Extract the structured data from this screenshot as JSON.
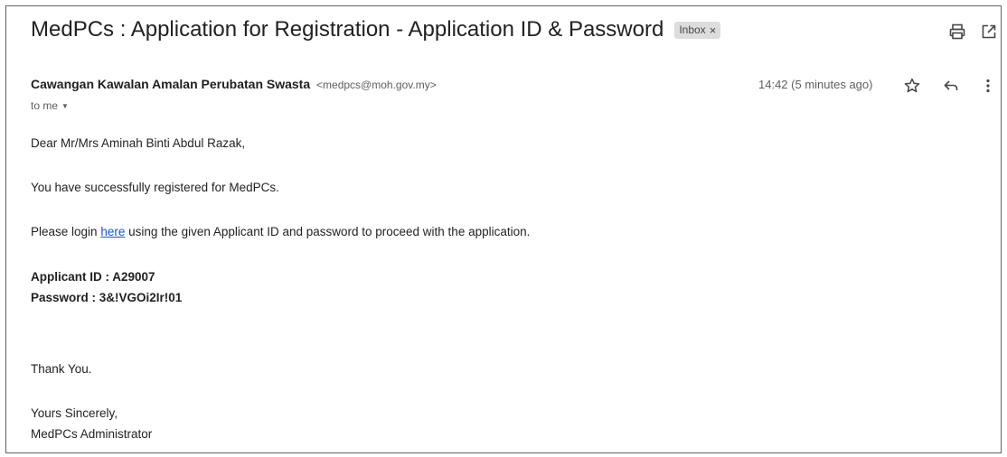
{
  "email": {
    "subject": "MedPCs : Application for Registration - Application ID & Password",
    "label_badge": "Inbox",
    "label_remove": "×",
    "sender_name": "Cawangan Kawalan Amalan Perubatan Swasta",
    "sender_email": "<medpcs@moh.gov.my>",
    "recipient": "to me",
    "timestamp": "14:42 (5 minutes ago)"
  },
  "body": {
    "greeting": "Dear Mr/Mrs Aminah Binti Abdul Razak,",
    "line1": "You have successfully registered for MedPCs.",
    "login_prefix": "Please login ",
    "login_link": "here",
    "login_suffix": " using the given Applicant ID and password to proceed with the application.",
    "applicant_id": "Applicant ID : A29007",
    "password": "Password : 3&!VGOi2Ir!01",
    "thanks": "Thank You.",
    "closing": "Yours Sincerely,",
    "signature": "MedPCs Administrator"
  },
  "icons": {
    "print": "print-icon",
    "open_new_window": "open-in-new-window-icon",
    "star": "star-icon",
    "reply": "reply-icon",
    "more": "more-vertical-icon",
    "caret": "chevron-down-icon"
  }
}
